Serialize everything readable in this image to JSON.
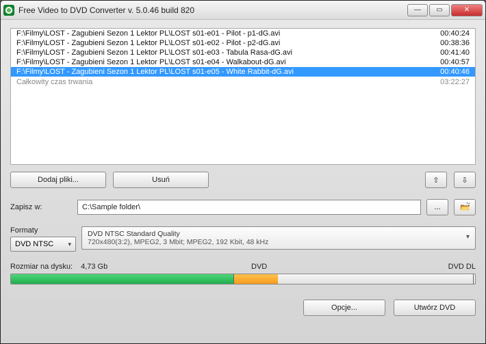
{
  "window": {
    "title": "Free Video to DVD Converter  v. 5.0.46 build 820"
  },
  "files": [
    {
      "path": "F:\\Filmy\\LOST - Zagubieni Sezon 1 Lektor PL\\LOST s01-e01 - Pilot - p1-dG.avi",
      "duration": "00:40:24",
      "selected": false
    },
    {
      "path": "F:\\Filmy\\LOST - Zagubieni Sezon 1 Lektor PL\\LOST s01-e02 - Pilot - p2-dG.avi",
      "duration": "00:38:36",
      "selected": false
    },
    {
      "path": "F:\\Filmy\\LOST - Zagubieni Sezon 1 Lektor PL\\LOST s01-e03 - Tabula Rasa-dG.avi",
      "duration": "00:41:40",
      "selected": false
    },
    {
      "path": "F:\\Filmy\\LOST - Zagubieni Sezon 1 Lektor PL\\LOST s01-e04 - Walkabout-dG.avi",
      "duration": "00:40:57",
      "selected": false
    },
    {
      "path": "F:\\Filmy\\LOST - Zagubieni Sezon 1 Lektor PL\\LOST s01-e05 - White Rabbit-dG.avi",
      "duration": "00:40:46",
      "selected": true
    }
  ],
  "total": {
    "label": "Całkowity czas trwania",
    "value": "03:22:27"
  },
  "buttons": {
    "add": "Dodaj pliki...",
    "remove": "Usuń",
    "up": "⇧",
    "down": "⇩",
    "browse": "...",
    "options": "Opcje...",
    "create": "Utwórz DVD"
  },
  "save": {
    "label": "Zapisz w:",
    "path": "C:\\Sample folder\\"
  },
  "format": {
    "label": "Formaty",
    "selected": "DVD NTSC",
    "quality_title": "DVD NTSC Standard Quality",
    "quality_detail": "720x480(3:2), MPEG2, 3 Mbit; MPEG2, 192 Kbit, 48 kHz"
  },
  "disk": {
    "label": "Rozmiar na dysku:",
    "size": "4,73 Gb",
    "mark1": "DVD",
    "mark2": "DVD DL"
  }
}
